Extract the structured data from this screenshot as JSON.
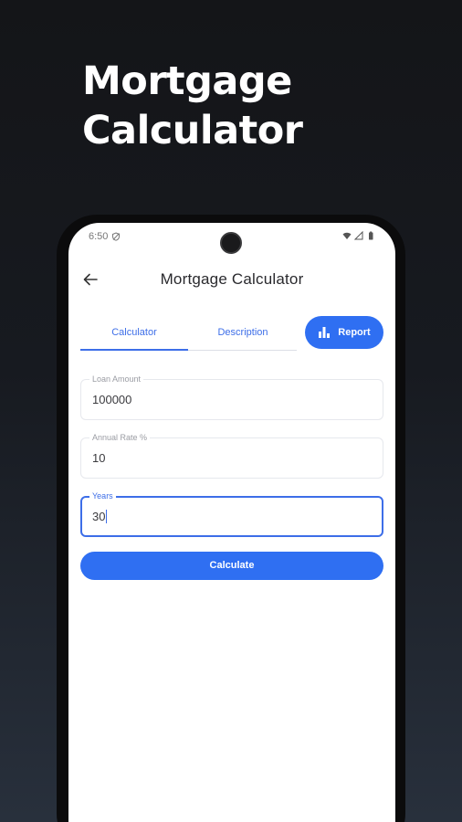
{
  "promo": {
    "title_line1": "Mortgage",
    "title_line2": "Calculator"
  },
  "status_bar": {
    "time": "6:50"
  },
  "appbar": {
    "title": "Mortgage Calculator"
  },
  "tabs": [
    {
      "label": "Calculator",
      "selected": true
    },
    {
      "label": "Description",
      "selected": false
    }
  ],
  "report_button": {
    "label": "Report",
    "icon": "bar-chart-icon"
  },
  "form": {
    "loan_amount": {
      "label": "Loan Amount",
      "value": "100000"
    },
    "annual_rate": {
      "label": "Annual Rate %",
      "value": "10"
    },
    "years": {
      "label": "Years",
      "value": "30"
    }
  },
  "calculate_button": {
    "label": "Calculate"
  },
  "colors": {
    "accent": "#2f6ff2",
    "tab_text": "#3d6ee8",
    "background": "#141518"
  }
}
